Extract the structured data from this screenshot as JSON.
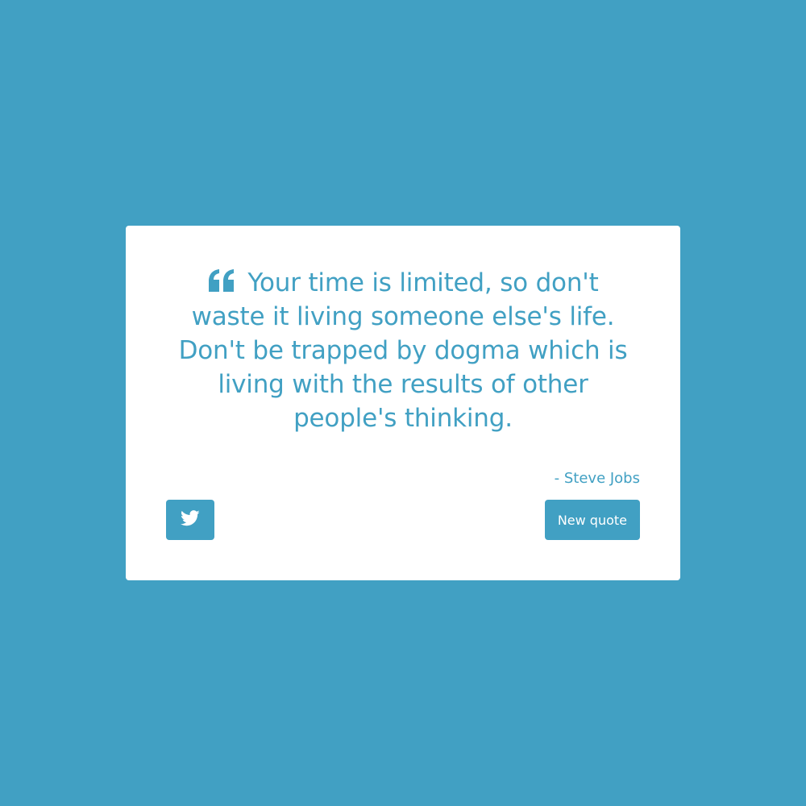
{
  "theme": {
    "accent": "#41a0c3",
    "card_background": "#ffffff"
  },
  "quote": {
    "icon": "quote-left-icon",
    "text": "Your time is limited, so don't waste it living someone else's life. Don't be trapped by dogma which is living with the results of other people's thinking.",
    "author": "- Steve Jobs"
  },
  "actions": {
    "tweet_icon": "twitter-icon",
    "new_quote_label": "New quote"
  }
}
